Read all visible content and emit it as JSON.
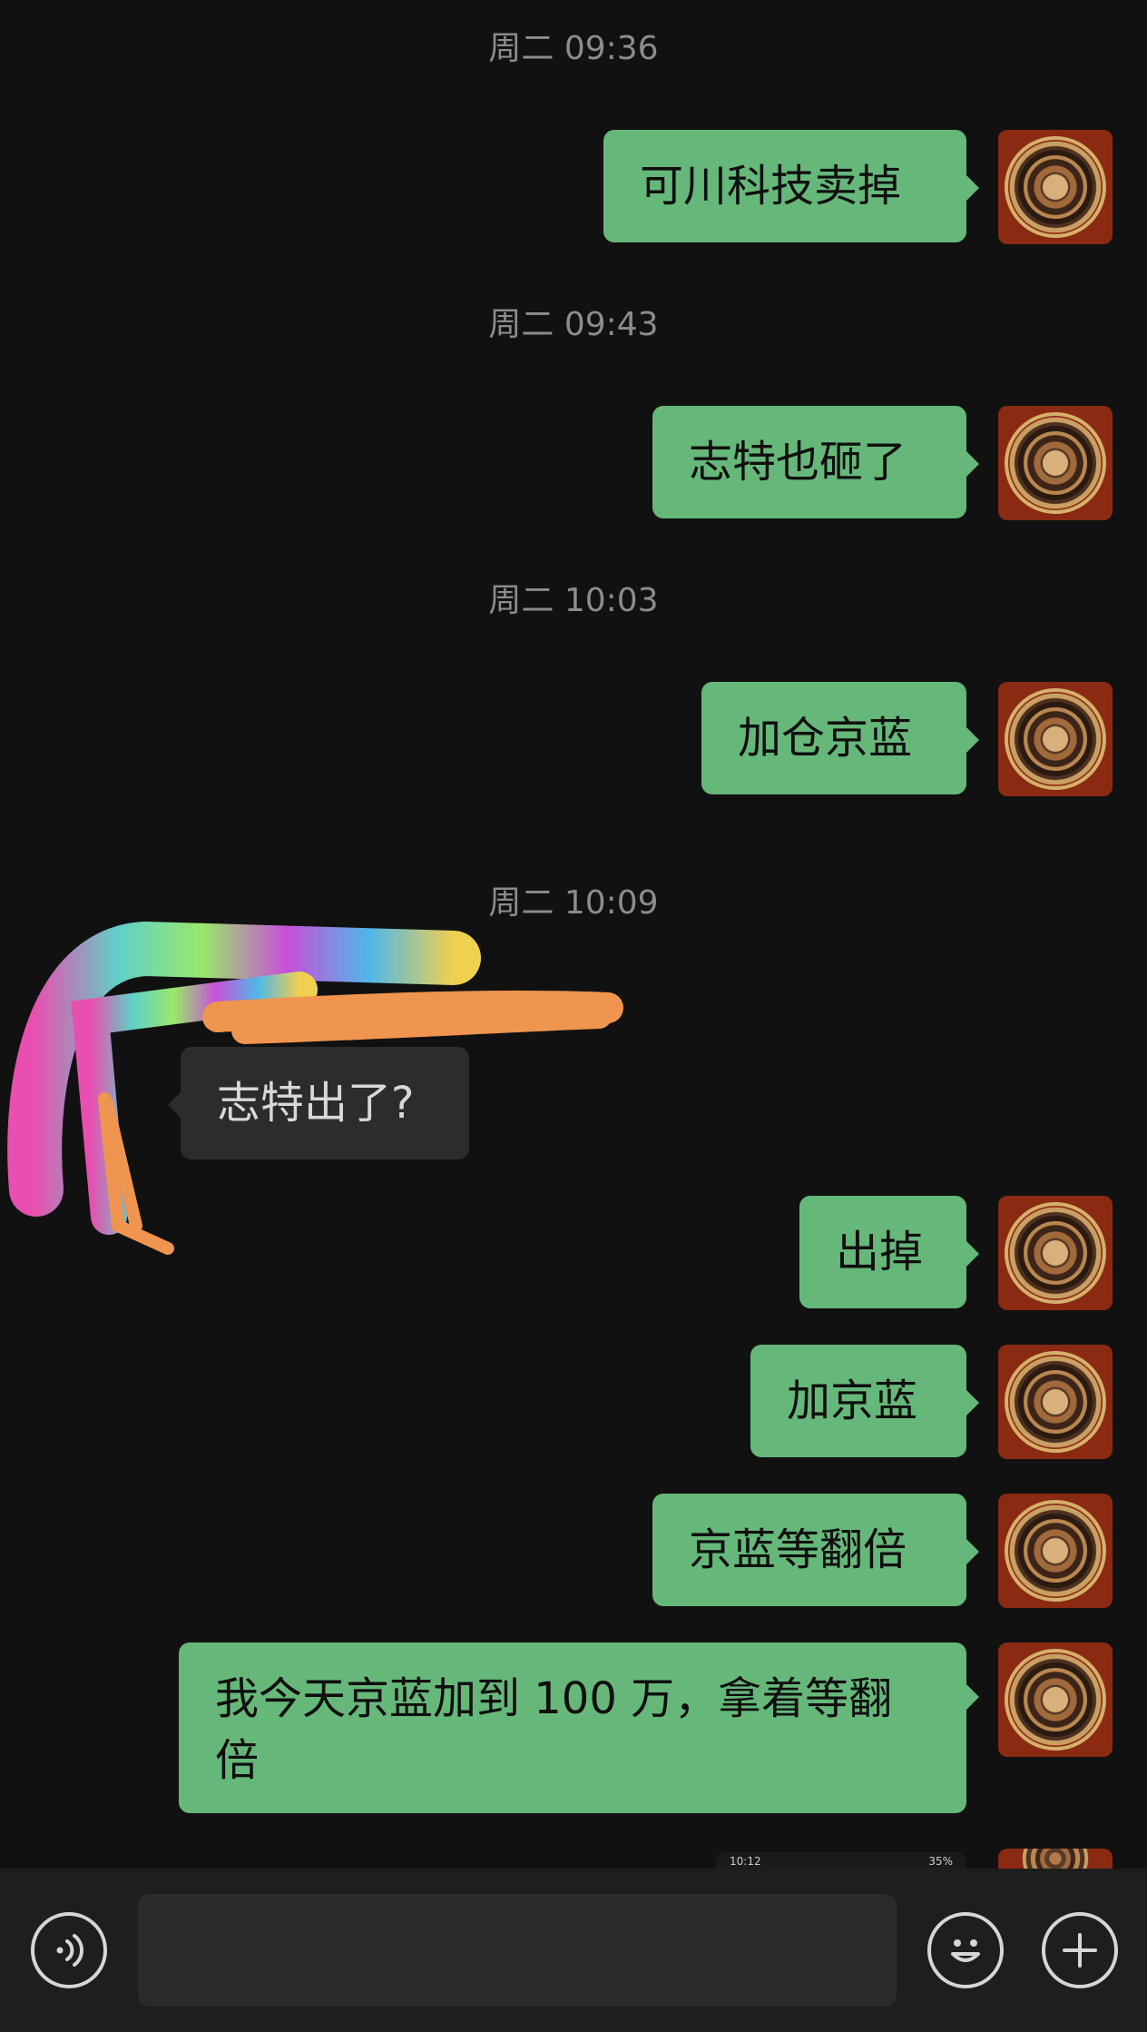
{
  "messages": {
    "ts1": "周二 09:36",
    "m1": "可川科技卖掉",
    "ts2": "周二 09:43",
    "m2": "志特也砸了",
    "ts3": "周二 10:03",
    "m3": "加仓京蓝",
    "ts4": "周二 10:09",
    "m4": "志特出了?",
    "m5": "出掉",
    "m6": "加京蓝",
    "m7": "京蓝等翻倍",
    "m8": "我今天京蓝加到 100 万，拿着等翻倍"
  },
  "thumbnail": {
    "time": "10:12",
    "battery": "35%"
  },
  "toolbar": {
    "voice_icon": "voice-icon",
    "emoji_icon": "emoji-icon",
    "plus_icon": "plus-icon",
    "input_value": ""
  },
  "colors": {
    "background": "#111111",
    "outgoing_bubble": "#66b87a",
    "incoming_bubble": "#2c2c2c",
    "timestamp": "#8c8c8c"
  }
}
